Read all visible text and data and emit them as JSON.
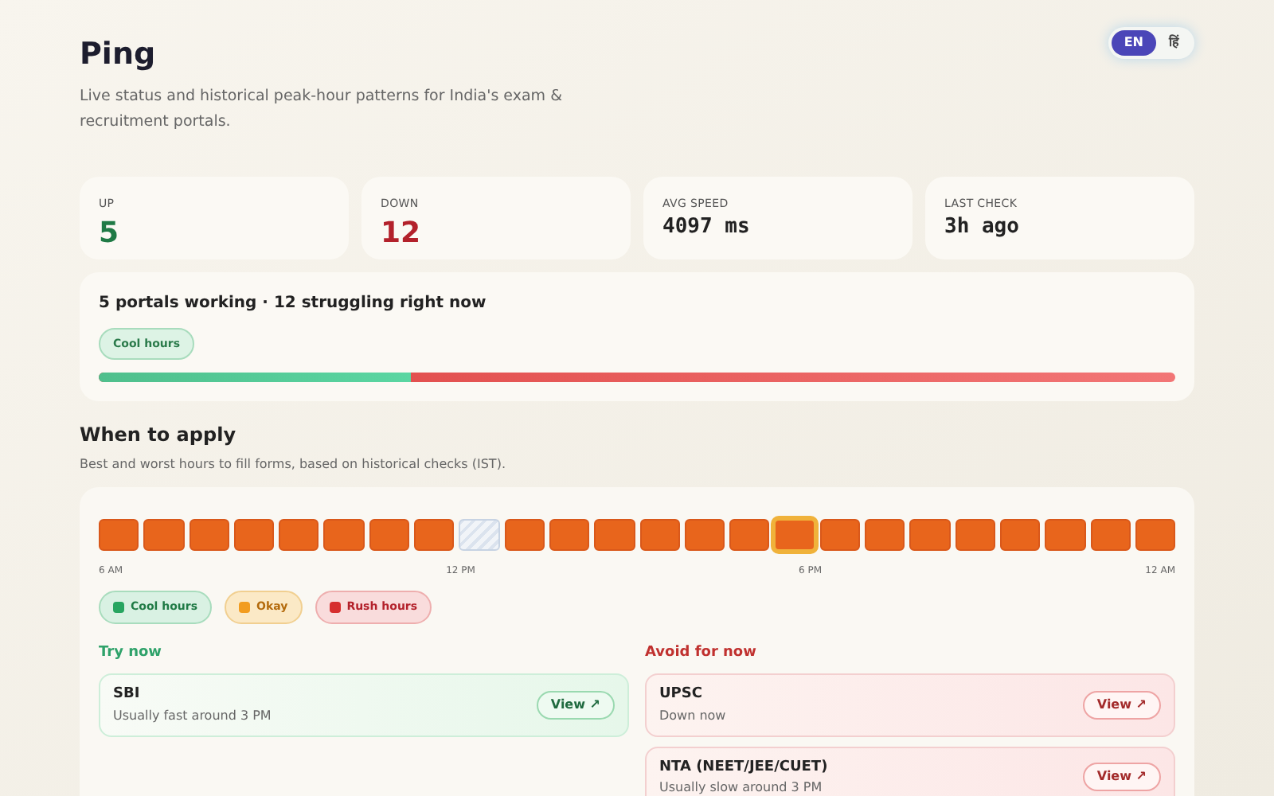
{
  "header": {
    "title": "Ping",
    "subtitle": "Live status and historical peak-hour patterns for India's exam & recruitment portals."
  },
  "language": [
    {
      "label": "EN",
      "selected": true
    },
    {
      "label": "हिं",
      "selected": false
    }
  ],
  "stats": [
    {
      "label": "UP",
      "value": "5",
      "kind": "good"
    },
    {
      "label": "DOWN",
      "value": "12",
      "kind": "bad"
    },
    {
      "label": "AVG SPEED",
      "value": "4097 ms",
      "kind": "mono"
    },
    {
      "label": "LAST CHECK",
      "value": "3h ago",
      "kind": "mono"
    }
  ],
  "summary": {
    "headline": "5 portals working · 12 struggling right now",
    "badge": "Cool hours",
    "level": 0.29
  },
  "schedule": {
    "title": "When to apply",
    "subtitle": "Best and worst hours to fill forms, based on historical checks (IST).",
    "hours": [
      {
        "kind": "busy",
        "selected": false
      },
      {
        "kind": "busy",
        "selected": false
      },
      {
        "kind": "busy",
        "selected": false
      },
      {
        "kind": "busy",
        "selected": false
      },
      {
        "kind": "busy",
        "selected": false
      },
      {
        "kind": "busy",
        "selected": false
      },
      {
        "kind": "busy",
        "selected": false
      },
      {
        "kind": "busy",
        "selected": false
      },
      {
        "kind": "nodata",
        "selected": false
      },
      {
        "kind": "busy",
        "selected": false
      },
      {
        "kind": "busy",
        "selected": false
      },
      {
        "kind": "busy",
        "selected": false
      },
      {
        "kind": "busy",
        "selected": false
      },
      {
        "kind": "busy",
        "selected": false
      },
      {
        "kind": "busy",
        "selected": false
      },
      {
        "kind": "busy",
        "selected": true
      },
      {
        "kind": "busy",
        "selected": false
      },
      {
        "kind": "busy",
        "selected": false
      },
      {
        "kind": "busy",
        "selected": false
      },
      {
        "kind": "busy",
        "selected": false
      },
      {
        "kind": "busy",
        "selected": false
      },
      {
        "kind": "busy",
        "selected": false
      },
      {
        "kind": "busy",
        "selected": false
      },
      {
        "kind": "busy",
        "selected": false
      }
    ],
    "axis": [
      "6 AM",
      "12 PM",
      "6 PM",
      "12 AM"
    ],
    "legend": [
      {
        "label": "Cool hours",
        "kind": "cool"
      },
      {
        "label": "Okay",
        "kind": "okay"
      },
      {
        "label": "Rush hours",
        "kind": "rush"
      }
    ]
  },
  "try_now": {
    "title": "Try now",
    "items": [
      {
        "name": "SBI",
        "note": "Usually fast around 3 PM",
        "action": "View ↗"
      }
    ]
  },
  "avoid": {
    "title": "Avoid for now",
    "items": [
      {
        "name": "UPSC",
        "note": "Down now",
        "action": "View ↗"
      },
      {
        "name": "NTA (NEET/JEE/CUET)",
        "note": "Usually slow around 3 PM",
        "action": "View ↗"
      }
    ]
  }
}
